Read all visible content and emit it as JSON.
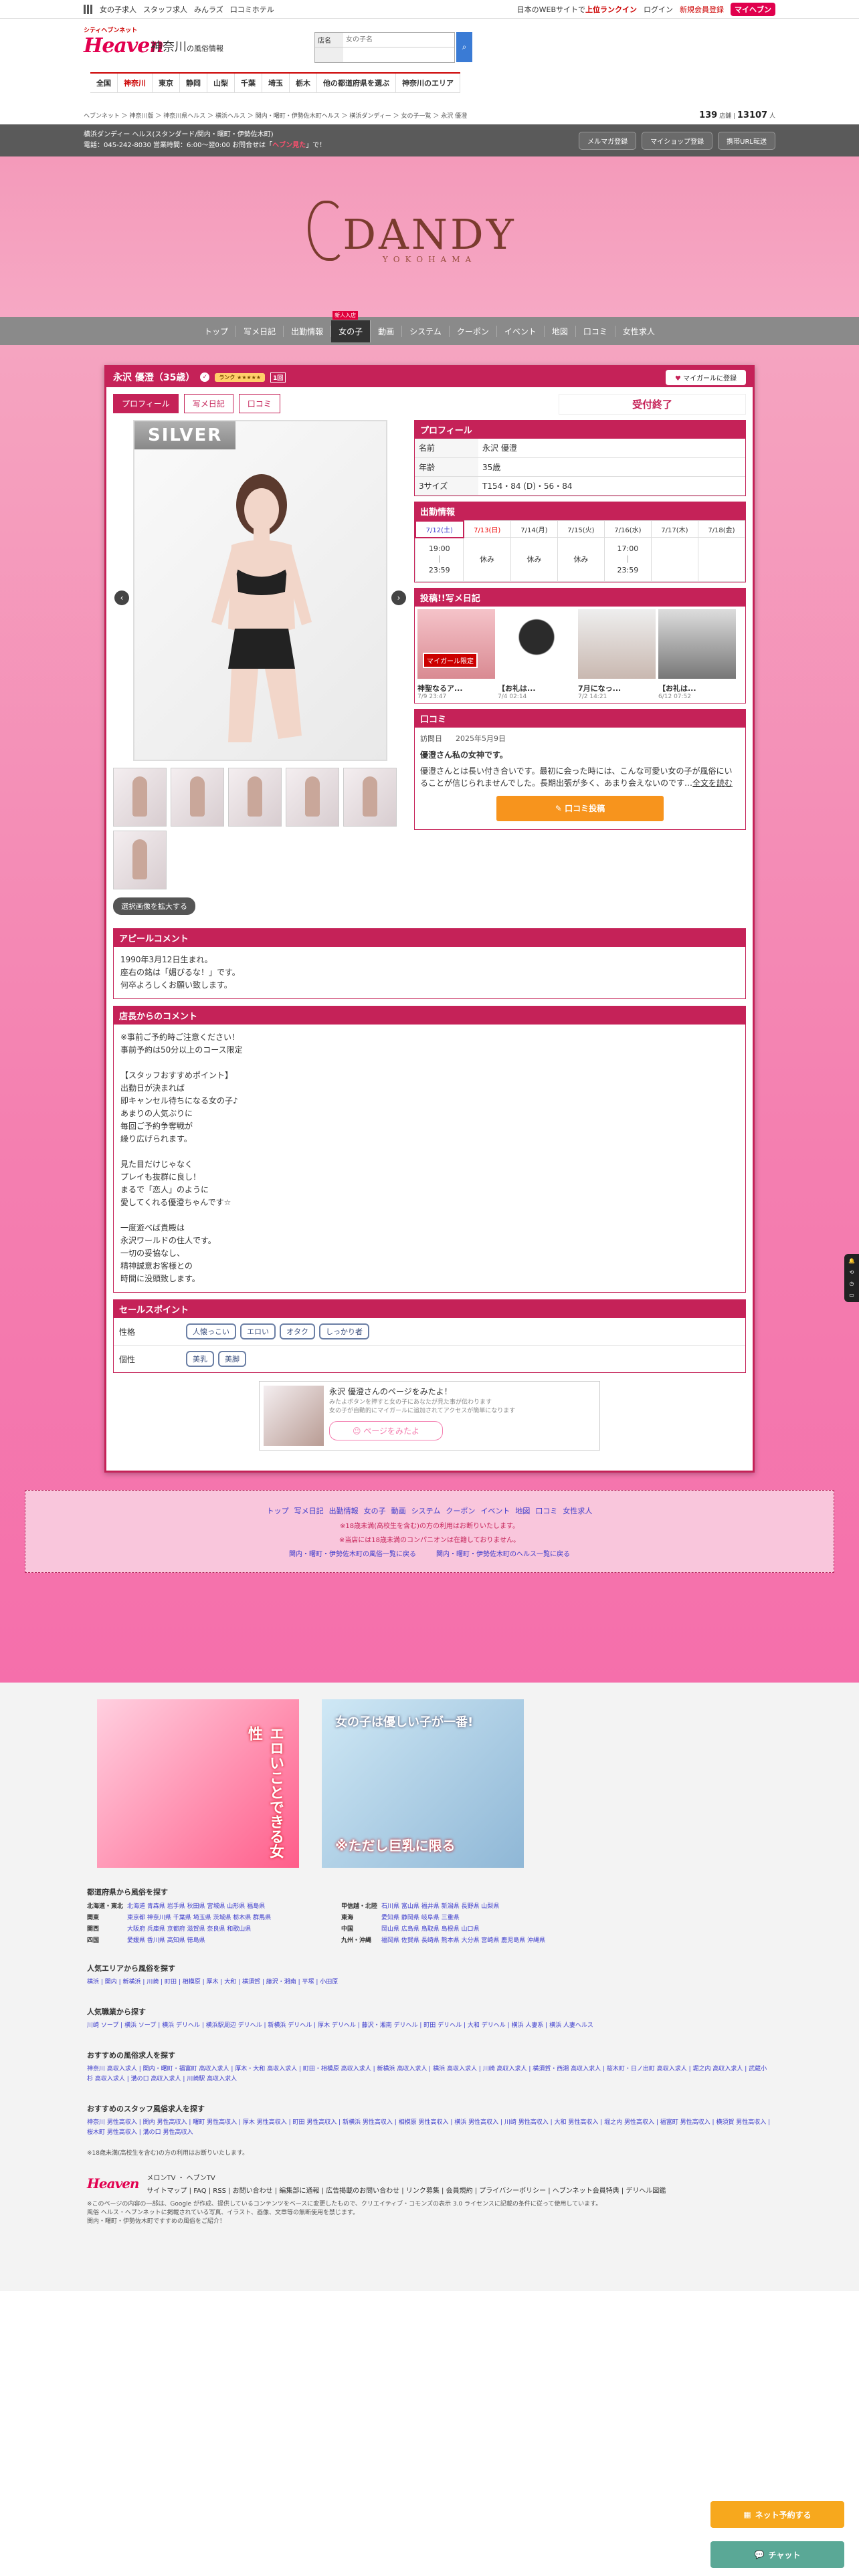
{
  "topbar": {
    "links": [
      "女の子求人",
      "スタッフ求人",
      "みんラズ",
      "口コミホテル"
    ],
    "right_text": "日本のWEBサイトで",
    "right_highlight": "上位ランクイン",
    "login": "ログイン",
    "register": "新規会員登録",
    "myheaven": "マイヘブン"
  },
  "header": {
    "logo": "Heaven",
    "logo_sub": "シティヘブンネット",
    "area": "神奈川",
    "area_sub": "の風俗情報",
    "search_label1": "店名",
    "search_placeholder1": "女の子名",
    "search_label2": "",
    "nav": [
      "全国",
      "神奈川",
      "東京",
      "静岡",
      "山梨",
      "千葉",
      "埼玉",
      "栃木",
      "他の都道府県を選ぶ",
      "神奈川のエリア"
    ]
  },
  "crumbs": {
    "path": "ヘブンネット ＞ 神奈川版 ＞ 神奈川県ヘルス ＞ 横浜ヘルス ＞ 関内・曙町・伊勢佐木町ヘルス ＞ 横浜ダンディー ＞ 女の子一覧 ＞ 永沢 優澄",
    "count1": "139",
    "count1_unit": "店舗",
    "count2": "13107",
    "count2_unit": "人"
  },
  "shop": {
    "line1": "横浜ダンディー ヘルス(スタンダード/関内・曙町・伊勢佐木町)",
    "line2": "電話：045-242-8030 営業時間：6:00～翌0:00 お問合せは「",
    "hot": "ヘブン見た",
    "line2_end": "」で！",
    "buttons": [
      "メルマガ登録",
      "マイショップ登録",
      "携帯URL転送"
    ]
  },
  "hero": {
    "logo": "DANDY",
    "sub": "YOKOHAMA"
  },
  "shopnav": {
    "items": [
      "トップ",
      "写メ日記",
      "出勤情報",
      "女の子",
      "動画",
      "システム",
      "クーポン",
      "イベント",
      "地図",
      "口コミ",
      "女性求人"
    ],
    "new_tag": "新人入店"
  },
  "girl": {
    "name": "永沢 優澄（35歳）",
    "rank": "ランク",
    "rank_num": "1回",
    "fav": "マイガールに登録",
    "tabs": [
      "プロフィール",
      "写メ日記",
      "口コミ"
    ],
    "photo_label": "SILVER",
    "status": "受付終了",
    "choose": "選択画像を拡大する"
  },
  "profile": {
    "title": "プロフィール",
    "rows": [
      {
        "k": "名前",
        "v": "永沢 優澄"
      },
      {
        "k": "年齢",
        "v": "35歳"
      },
      {
        "k": "3サイズ",
        "v": "T154・84 (D)・56・84"
      }
    ]
  },
  "schedule": {
    "title": "出勤情報",
    "days": [
      "7/12(土)",
      "7/13(日)",
      "7/14(月)",
      "7/15(火)",
      "7/16(水)",
      "7/17(木)",
      "7/18(金)"
    ],
    "values": [
      "19:00\n｜\n23:59",
      "休み",
      "休み",
      "休み",
      "17:00\n｜\n23:59",
      "",
      ""
    ]
  },
  "diary": {
    "title": "投稿!!写メ日記",
    "items": [
      {
        "t": "神聖なるア...",
        "d": "7/9 23:47",
        "badge": "マイガール限定"
      },
      {
        "t": "【お礼は...",
        "d": "7/4 02:14",
        "badge": ""
      },
      {
        "t": "7月になっ...",
        "d": "7/2 14:21",
        "badge": ""
      },
      {
        "t": "【お礼は...",
        "d": "6/12 07:52",
        "badge": ""
      }
    ]
  },
  "review": {
    "title": "口コミ",
    "date_label": "訪問日",
    "date": "2025年5月9日",
    "heading": "優澄さん私の女神です。",
    "body": "優澄さんとは長い付き合いです。最初に会った時には、こんな可愛い女の子が風俗にいることが信じられませんでした。長期出張が多く、あまり会えないのです…",
    "more": "全文を読む",
    "button": "口コミ投稿"
  },
  "appeal": {
    "title": "アピールコメント",
    "body": "1990年3月12日生まれ。\n座右の銘は「媚びるな！」です。\n何卒よろしくお願い致します。"
  },
  "manager": {
    "title": "店長からのコメント",
    "body": "※事前ご予約時ご注意ください！\n事前予約は50分以上のコース限定\n\n【スタッフおすすめポイント】\n出勤日が決まれば\n即キャンセル待ちになる女の子♪\nあまりの人気ぶりに\n毎回ご予約争奪戦が\n繰り広げられます。\n\n見た目だけじゃなく\nプレイも抜群に良し！\nまるで「恋人」のように\n愛してくれる優澄ちゃんです☆\n\n一度遊べば貴殿は\n永沢ワールドの住人です。\n一切の妥協なし、\n精神誠意お客様との\n時間に没頭致します。"
  },
  "sales": {
    "title": "セールスポイント",
    "rows": [
      {
        "k": "性格",
        "tags": [
          "人懐っこい",
          "エロい",
          "オタク",
          "しっかり者"
        ]
      },
      {
        "k": "個性",
        "tags": [
          "美乳",
          "美脚"
        ]
      }
    ]
  },
  "promo": {
    "title": "永沢 優澄さんのページをみたよ！",
    "sub": "みたよボタンを押すと女の子にあなたが見た事が伝わります\n女の子が自動的にマイガールに追加されてアクセスが簡単になります",
    "button": "ページをみたよ"
  },
  "bottomnav": {
    "links": [
      "トップ",
      "写メ日記",
      "出勤情報",
      "女の子",
      "動画",
      "システム",
      "クーポン",
      "イベント",
      "地図",
      "口コミ",
      "女性求人"
    ],
    "note1": "※18歳未満(高校生を含む)の方の利用はお断りいたします。",
    "note2": "※当店には18歳未満のコンパニオンは在籍しておりません。",
    "back1": "関内・曙町・伊勢佐木町の風俗一覧に戻る",
    "back2": "関内・曙町・伊勢佐木町のヘルス一覧に戻る"
  },
  "footer": {
    "banner1_text": "エロいことできる女性",
    "banner2_text": "女の子は優しい子が一番!",
    "banner2_sub": "※ただし巨乳に限る",
    "pref_title": "都道府県から風俗を探す",
    "prefs": [
      [
        "北海道・東北",
        "北海道 青森県 岩手県 秋田県 宮城県 山形県 福島県"
      ],
      [
        "甲信越・北陸",
        "石川県 富山県 福井県 新潟県 長野県 山梨県"
      ],
      [
        "関東",
        "東京都 神奈川県 千葉県 埼玉県 茨城県 栃木県 群馬県"
      ],
      [
        "東海",
        "愛知県 静岡県 岐阜県 三重県"
      ],
      [
        "関西",
        "大阪府 兵庫県 京都府 滋賀県 奈良県 和歌山県"
      ],
      [
        "中国",
        "岡山県 広島県 鳥取県 島根県 山口県"
      ],
      [
        "四国",
        "愛媛県 香川県 高知県 徳島県"
      ],
      [
        "九州・沖縄",
        "福岡県 佐賀県 長崎県 熊本県 大分県 宮崎県 鹿児島県 沖縄県"
      ]
    ],
    "popular_title": "人気エリアから風俗を探す",
    "popular": "横浜 | 関内 | 新横浜 | 川崎 | 町田 | 相模原 | 厚木 | 大和 | 横須賀 | 藤沢・湘南 | 平塚 | 小田原",
    "job_title": "人気職業から探す",
    "jobs": "川崎 ソープ | 横浜 ソープ | 横浜 デリヘル | 横浜駅周辺 デリヘル | 新横浜 デリヘル | 厚木 デリヘル | 藤沢・湘南 デリヘル | 町田 デリヘル | 大和 デリヘル | 横浜 人妻系 | 横浜 人妻ヘルス",
    "rec_title": "おすすめの風俗求人を探す",
    "rec": "神奈川 高収入求人 | 関内・曙町・福富町 高収入求人 | 厚木・大和 高収入求人 | 町田・相模原 高収入求人 | 新横浜 高収入求人 | 横浜 高収入求人 | 川崎 高収入求人 | 横須賀・西湘 高収入求人 | 桜木町・日ノ出町 高収入求人 | 堀之内 高収入求人 | 武蔵小杉 高収入求人 | 溝の口 高収入求人 | 川崎駅 高収入求人",
    "staff_title": "おすすめのスタッフ風俗求人を探す",
    "staff": "神奈川 男性高収入 | 関内 男性高収入 | 曙町 男性高収入 | 厚木 男性高収入 | 町田 男性高収入 | 新横浜 男性高収入 | 相模原 男性高収入 | 横浜 男性高収入 | 川崎 男性高収入 | 大和 男性高収入 | 堀之内 男性高収入 | 福富町 男性高収入 | 横須賀 男性高収入 | 桜木町 男性高収入 | 溝の口 男性高収入",
    "age_note": "※18歳未満(高校生を含む)の方の利用はお断りいたします。",
    "tv1": "メロンTV",
    "tv2": "ヘブンTV",
    "menus": "サイトマップ | FAQ | RSS | お問い合わせ | 編集部に通報 | 広告掲載のお問い合わせ | リンク募集 | 会員規約 | プライバシーポリシー | ヘブンネット会員特典 | デリヘル図鑑",
    "copy": "※このページの内容の一部は、Google が作成、提供しているコンテンツをベースに変更したもので、クリエイティブ・コモンズの表示 3.0 ライセンスに記載の条件に従って使用しています。\n風俗 ヘルス・ヘブンネットに掲載されている写真、イラスト、画像、文章等の無断使用を禁じます。\n関内・曙町・伊勢佐木町ですすめの風俗をご紹介！"
  },
  "float": {
    "net": "ネット予約する",
    "chat": "チャット"
  }
}
